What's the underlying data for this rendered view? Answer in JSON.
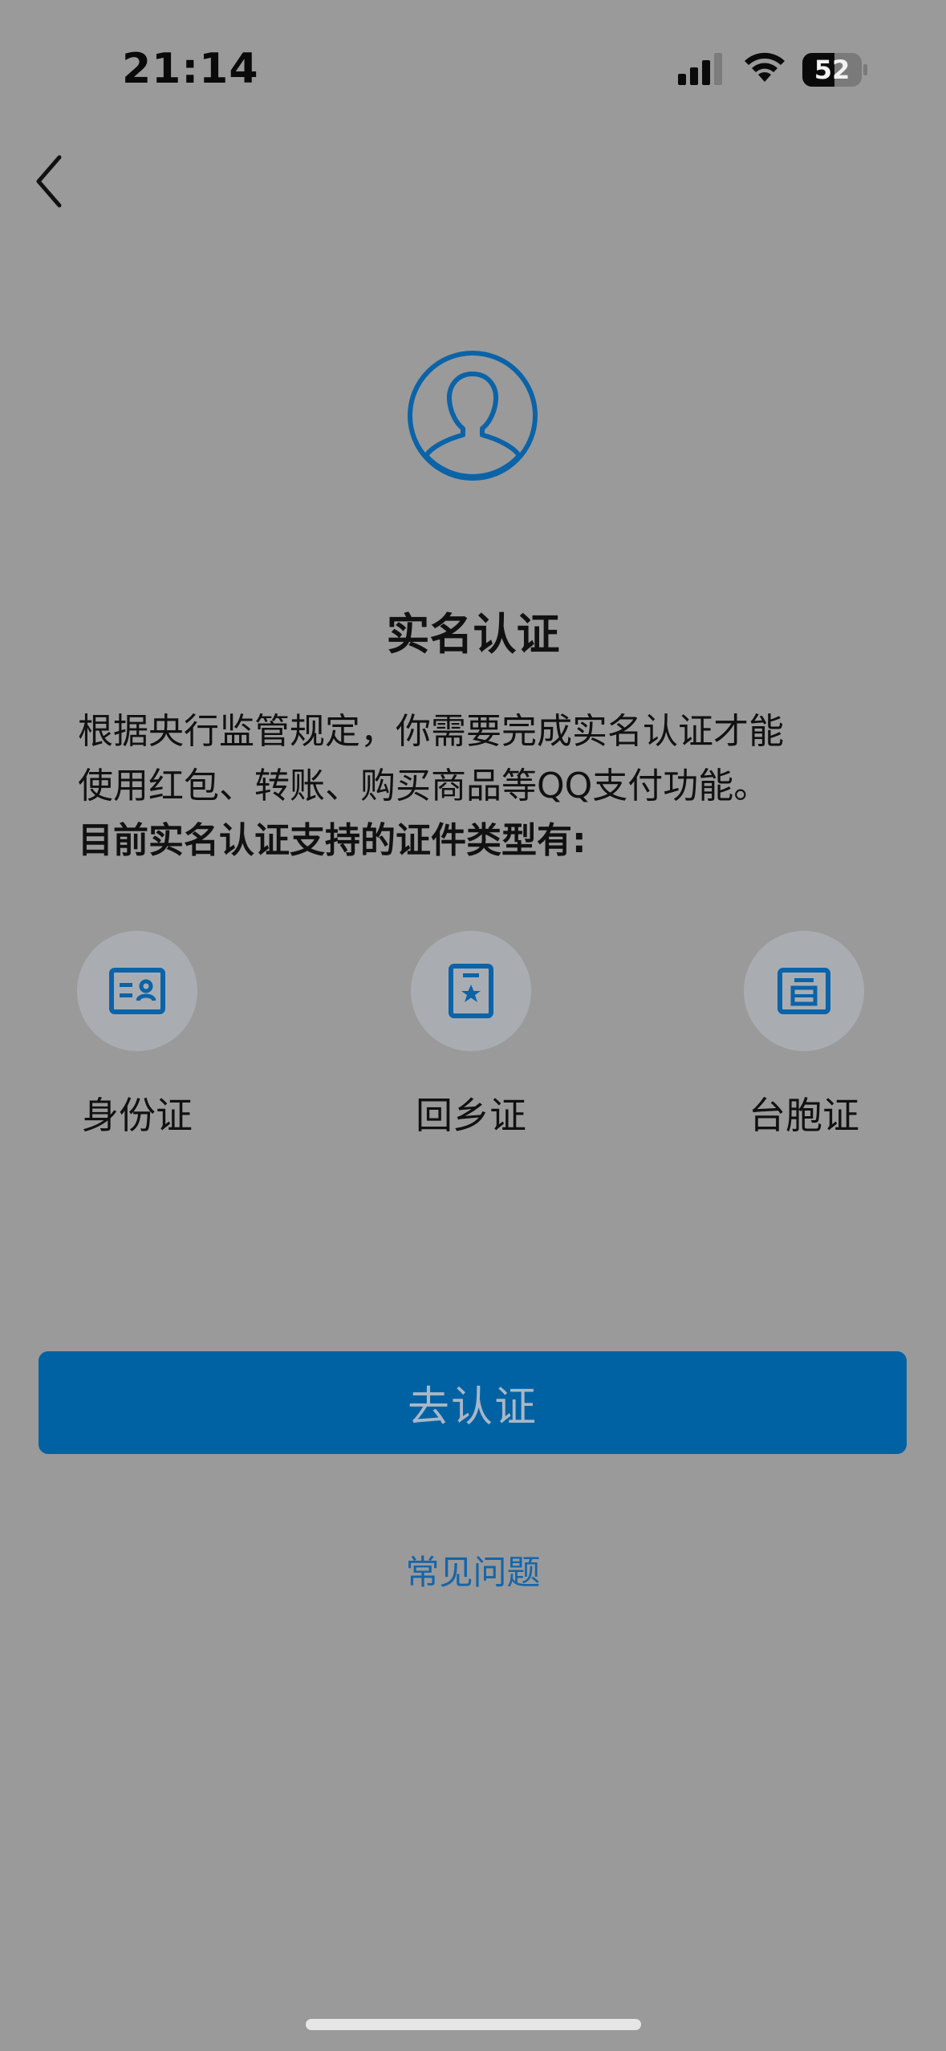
{
  "status_bar": {
    "time": "21:14",
    "battery": "52"
  },
  "header": {
    "back_icon": "chevron-left-icon"
  },
  "main": {
    "avatar_icon": "user-circle-icon",
    "title": "实名认证",
    "description_line1": "根据央行监管规定，你需要完成实名认证才能",
    "description_line2": "使用红包、转账、购买商品等QQ支付功能。",
    "description_bold": "目前实名认证支持的证件类型有:",
    "id_types": [
      {
        "label": "身份证",
        "icon": "id-card-icon"
      },
      {
        "label": "回乡证",
        "icon": "home-return-permit-icon"
      },
      {
        "label": "台胞证",
        "icon": "taiwan-compatriot-permit-icon"
      }
    ],
    "primary_button": "去认证",
    "faq_link": "常见问题"
  },
  "colors": {
    "accent": "#0062a3",
    "link": "#1565a9",
    "background": "#9a9a9a"
  }
}
